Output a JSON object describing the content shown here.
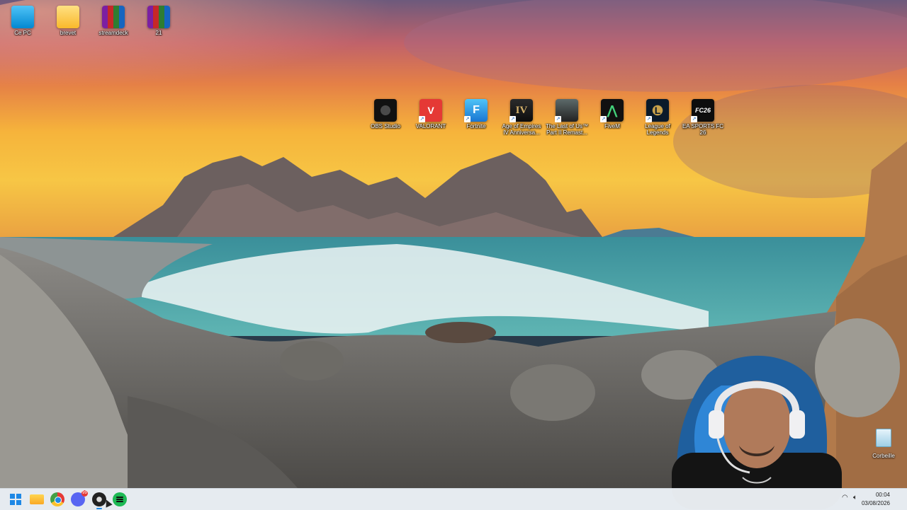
{
  "desktop": {
    "top_icons": [
      {
        "label": "Ce PC",
        "icon": "this-pc-icon"
      },
      {
        "label": "brevet",
        "icon": "folder-icon"
      },
      {
        "label": "streamdeck",
        "icon": "winrar-archive-icon"
      },
      {
        "label": "21",
        "icon": "winrar-archive-icon"
      }
    ],
    "game_icons": [
      {
        "label": "OBS Studio",
        "icon": "obs-studio-icon"
      },
      {
        "label": "VALORANT",
        "icon": "valorant-icon"
      },
      {
        "label": "Fortnite",
        "icon": "fortnite-icon",
        "glyph": "F"
      },
      {
        "label": "Age of Empires IV Anniversa...",
        "icon": "age-of-empires-icon",
        "glyph": "IV"
      },
      {
        "label": "The Last of Us™ Part II Remast...",
        "icon": "the-last-of-us-icon"
      },
      {
        "label": "FiveM",
        "icon": "fivem-icon",
        "glyph": "⋀"
      },
      {
        "label": "League of Legends",
        "icon": "league-of-legends-icon",
        "glyph": "L"
      },
      {
        "label": "EA SPORTS FC 26",
        "icon": "ea-sports-fc-icon",
        "glyph": "FC26"
      }
    ],
    "recycle_bin": {
      "label": "Corbeille",
      "icon": "recycle-bin-icon"
    }
  },
  "taskbar": {
    "apps": [
      {
        "name": "start",
        "icon": "windows-start-icon"
      },
      {
        "name": "file-explorer",
        "icon": "file-explorer-icon"
      },
      {
        "name": "chrome",
        "icon": "chrome-icon"
      },
      {
        "name": "discord",
        "icon": "discord-icon",
        "badge": "99"
      },
      {
        "name": "obs",
        "icon": "obs-studio-icon",
        "active": true
      },
      {
        "name": "spotify",
        "icon": "spotify-icon"
      }
    ],
    "tray": {
      "network_icon": "wifi-icon",
      "volume_icon": "volume-icon"
    },
    "clock": {
      "time": "00:04",
      "date": "03/08/2026"
    }
  },
  "colors": {
    "taskbar_bg": "#eef3f7",
    "accent": "#1e88e5"
  }
}
